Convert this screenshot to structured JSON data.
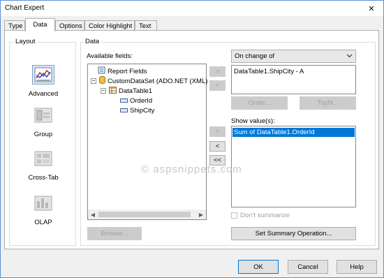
{
  "window": {
    "title": "Chart Expert",
    "close_glyph": "✕"
  },
  "tabs": [
    {
      "label": "Type"
    },
    {
      "label": "Data"
    },
    {
      "label": "Options"
    },
    {
      "label": "Color Highlight"
    },
    {
      "label": "Text"
    }
  ],
  "layout": {
    "label": "Layout",
    "items": [
      {
        "label": "Advanced",
        "icon": "advanced-chart-icon"
      },
      {
        "label": "Group",
        "icon": "group-chart-icon"
      },
      {
        "label": "Cross-Tab",
        "icon": "crosstab-chart-icon"
      },
      {
        "label": "OLAP",
        "icon": "olap-chart-icon"
      }
    ]
  },
  "data": {
    "label": "Data",
    "available_fields_label": "Available fields:",
    "tree": {
      "report_fields": "Report Fields",
      "dataset": "CustomDataSet (ADO.NET (XML)",
      "table": "DataTable1",
      "fields": [
        "OrderId",
        "ShipCity"
      ]
    },
    "browse_label": "Browse...",
    "move_right": ">",
    "move_left": "<",
    "move_all_left": "<<",
    "on_change_of": "On change of",
    "on_change_items": [
      "DataTable1.ShipCity - A"
    ],
    "order_label": "Order...",
    "topn_label": "TopN...",
    "show_values_label": "Show value(s):",
    "show_values_items": [
      "Sum of DataTable1.OrderId"
    ],
    "dont_summarize_label": "Don't summarize",
    "set_summary_label": "Set Summary Operation..."
  },
  "footer": {
    "ok": "OK",
    "cancel": "Cancel",
    "help": "Help"
  },
  "watermark": "© aspsnippets.com",
  "colors": {
    "accent": "#0078d7",
    "border": "#adadad",
    "panel": "#ffffff",
    "dialog": "#f0f0f0"
  }
}
